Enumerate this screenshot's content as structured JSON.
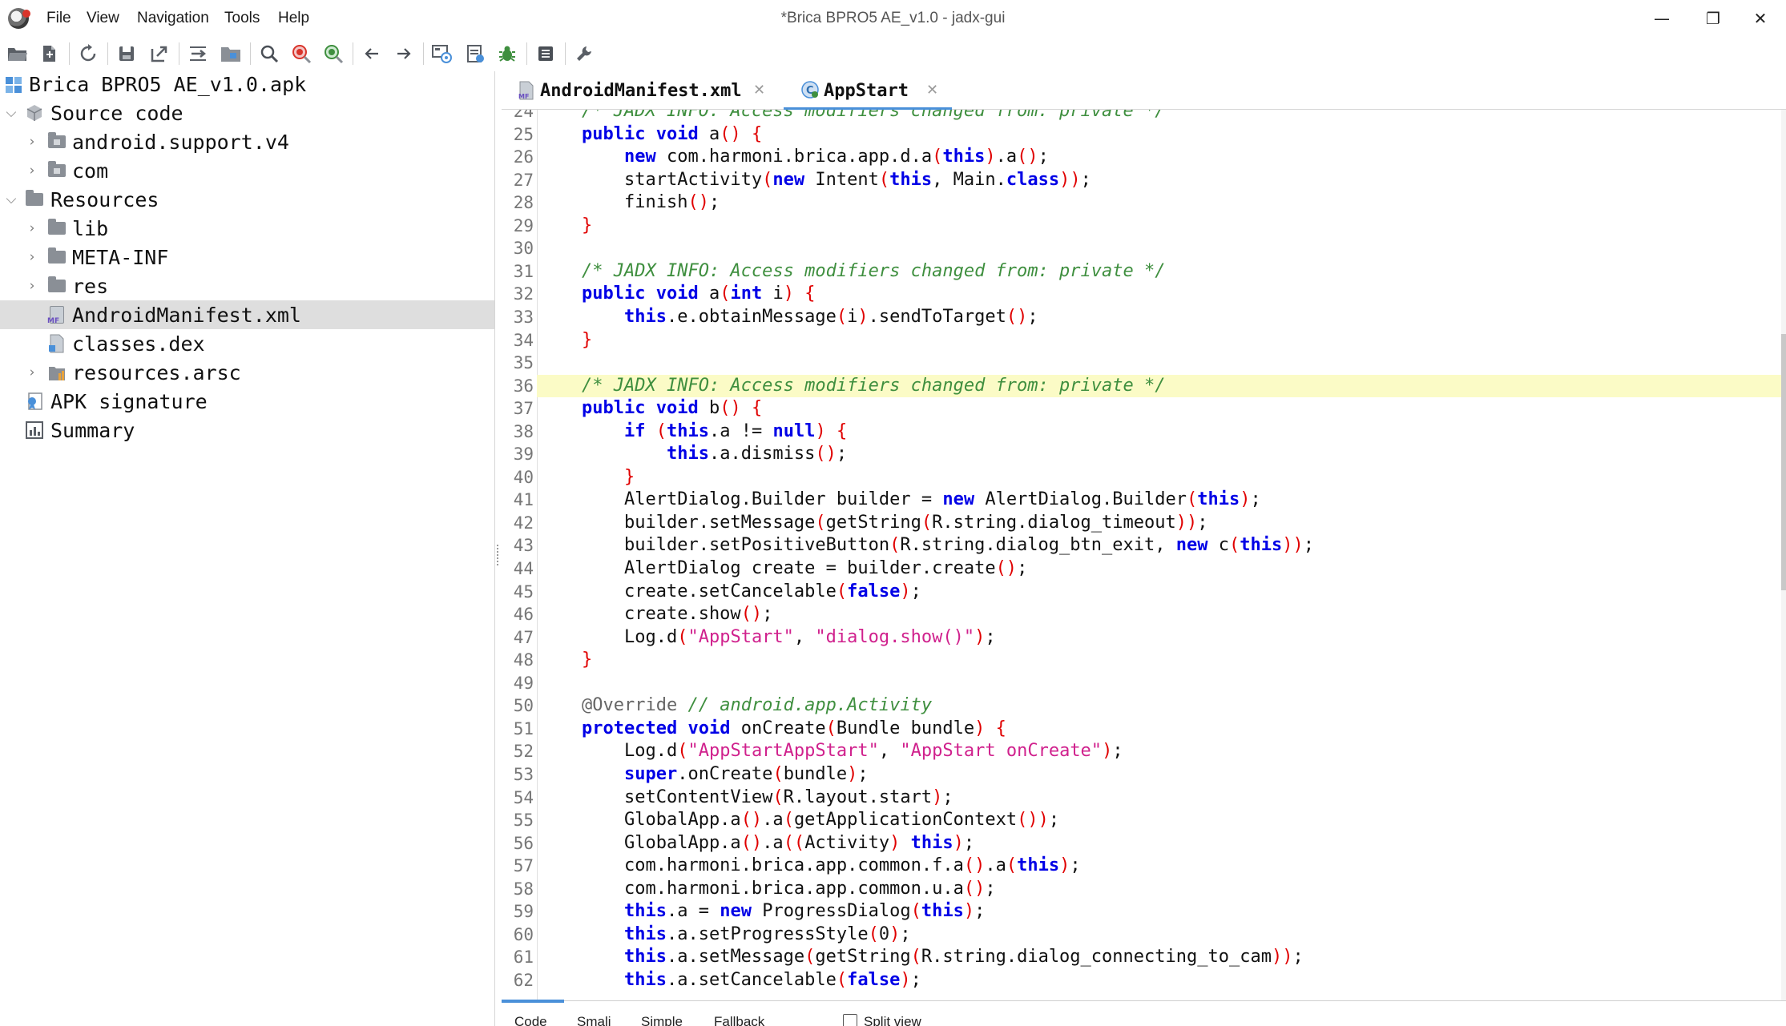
{
  "window": {
    "title": "*Brica BPRO5 AE_v1.0 - jadx-gui",
    "menu": [
      "File",
      "View",
      "Navigation",
      "Tools",
      "Help"
    ],
    "controls": {
      "minimize": "—",
      "restore": "❐",
      "close": "✕"
    }
  },
  "toolbar": {
    "buttons": [
      "open-file",
      "add-files",
      "sync",
      "save-all",
      "export",
      "sync-tree",
      "flatten-packages",
      "search-text",
      "search-class",
      "search-usage",
      "back",
      "forward",
      "deobfuscation",
      "decompile-all",
      "debug",
      "log-viewer",
      "preferences"
    ]
  },
  "tree": {
    "items": [
      {
        "label": "Brica BPRO5 AE_v1.0.apk",
        "icon": "apk-icon",
        "level": 0,
        "expander": ""
      },
      {
        "label": "Source code",
        "icon": "package-icon",
        "level": 0,
        "expander": "expanded"
      },
      {
        "label": "android.support.v4",
        "icon": "package-folder-icon",
        "level": 1,
        "expander": "collapsed"
      },
      {
        "label": "com",
        "icon": "package-folder-icon",
        "level": 1,
        "expander": "collapsed"
      },
      {
        "label": "Resources",
        "icon": "folder-icon",
        "level": 0,
        "expander": "expanded"
      },
      {
        "label": "lib",
        "icon": "folder-icon",
        "level": 1,
        "expander": "collapsed"
      },
      {
        "label": "META-INF",
        "icon": "folder-icon",
        "level": 1,
        "expander": "collapsed"
      },
      {
        "label": "res",
        "icon": "folder-icon",
        "level": 1,
        "expander": "collapsed"
      },
      {
        "label": "AndroidManifest.xml",
        "icon": "manifest-file-icon",
        "level": 1,
        "expander": "",
        "selected": true
      },
      {
        "label": "classes.dex",
        "icon": "dex-file-icon",
        "level": 1,
        "expander": ""
      },
      {
        "label": "resources.arsc",
        "icon": "arsc-file-icon",
        "level": 1,
        "expander": "collapsed"
      },
      {
        "label": "APK signature",
        "icon": "certificate-icon",
        "level": 0,
        "expander": ""
      },
      {
        "label": "Summary",
        "icon": "summary-icon",
        "level": 0,
        "expander": ""
      }
    ]
  },
  "tabs": [
    {
      "label": "AndroidManifest.xml",
      "close": "✕",
      "active": false
    },
    {
      "label": "AppStart",
      "close": "✕",
      "active": true
    }
  ],
  "code": {
    "highlight_line": 36,
    "lines": [
      {
        "n": "24",
        "tokens": [
          [
            "cm",
            "/* JADX INFO: Access modifiers changed from: private */"
          ]
        ]
      },
      {
        "n": "25",
        "tokens": [
          [
            "kw",
            "public"
          ],
          [
            "",
            " "
          ],
          [
            "kw",
            "void"
          ],
          [
            "",
            " a"
          ],
          [
            "br",
            "()"
          ],
          [
            "",
            " "
          ],
          [
            "br",
            "{"
          ]
        ]
      },
      {
        "n": "26",
        "tokens": [
          [
            "",
            "    "
          ],
          [
            "kw",
            "new"
          ],
          [
            "",
            " com.harmoni.brica.app.d.a"
          ],
          [
            "br",
            "("
          ],
          [
            "kw",
            "this"
          ],
          [
            "br",
            ")"
          ],
          [
            "",
            ".a"
          ],
          [
            "br",
            "()"
          ],
          [
            "",
            ";"
          ]
        ]
      },
      {
        "n": "27",
        "tokens": [
          [
            "",
            "    startActivity"
          ],
          [
            "br",
            "("
          ],
          [
            "kw",
            "new"
          ],
          [
            "",
            " Intent"
          ],
          [
            "br",
            "("
          ],
          [
            "kw",
            "this"
          ],
          [
            "",
            ", Main."
          ],
          [
            "kw",
            "class"
          ],
          [
            "br",
            "))"
          ],
          [
            "",
            ";"
          ]
        ]
      },
      {
        "n": "28",
        "tokens": [
          [
            "",
            "    finish"
          ],
          [
            "br",
            "()"
          ],
          [
            "",
            ";"
          ]
        ]
      },
      {
        "n": "29",
        "tokens": [
          [
            "br",
            "}"
          ]
        ]
      },
      {
        "n": "30",
        "tokens": []
      },
      {
        "n": "31",
        "tokens": [
          [
            "cm",
            "/* JADX INFO: Access modifiers changed from: private */"
          ]
        ]
      },
      {
        "n": "32",
        "tokens": [
          [
            "kw",
            "public"
          ],
          [
            "",
            " "
          ],
          [
            "kw",
            "void"
          ],
          [
            "",
            " a"
          ],
          [
            "br",
            "("
          ],
          [
            "kw",
            "int"
          ],
          [
            "",
            " i"
          ],
          [
            "br",
            ")"
          ],
          [
            "",
            " "
          ],
          [
            "br",
            "{"
          ]
        ]
      },
      {
        "n": "33",
        "tokens": [
          [
            "",
            "    "
          ],
          [
            "kw",
            "this"
          ],
          [
            "",
            ".e.obtainMessage"
          ],
          [
            "br",
            "("
          ],
          [
            "",
            "i"
          ],
          [
            "br",
            ")"
          ],
          [
            "",
            ".sendToTarget"
          ],
          [
            "br",
            "()"
          ],
          [
            "",
            ";"
          ]
        ]
      },
      {
        "n": "34",
        "tokens": [
          [
            "br",
            "}"
          ]
        ]
      },
      {
        "n": "35",
        "tokens": []
      },
      {
        "n": "36",
        "tokens": [
          [
            "cm",
            "/* JADX INFO: Access modifiers changed from: private */"
          ]
        ]
      },
      {
        "n": "37",
        "tokens": [
          [
            "kw",
            "public"
          ],
          [
            "",
            " "
          ],
          [
            "kw",
            "void"
          ],
          [
            "",
            " b"
          ],
          [
            "br",
            "()"
          ],
          [
            "",
            " "
          ],
          [
            "br",
            "{"
          ]
        ]
      },
      {
        "n": "38",
        "tokens": [
          [
            "",
            "    "
          ],
          [
            "kw",
            "if"
          ],
          [
            "",
            " "
          ],
          [
            "br",
            "("
          ],
          [
            "kw",
            "this"
          ],
          [
            "",
            ".a != "
          ],
          [
            "kw",
            "null"
          ],
          [
            "br",
            ")"
          ],
          [
            "",
            " "
          ],
          [
            "br",
            "{"
          ]
        ]
      },
      {
        "n": "39",
        "tokens": [
          [
            "",
            "        "
          ],
          [
            "kw",
            "this"
          ],
          [
            "",
            ".a.dismiss"
          ],
          [
            "br",
            "()"
          ],
          [
            "",
            ";"
          ]
        ]
      },
      {
        "n": "40",
        "tokens": [
          [
            "",
            "    "
          ],
          [
            "br",
            "}"
          ]
        ]
      },
      {
        "n": "41",
        "tokens": [
          [
            "",
            "    AlertDialog.Builder builder = "
          ],
          [
            "kw",
            "new"
          ],
          [
            "",
            " AlertDialog.Builder"
          ],
          [
            "br",
            "("
          ],
          [
            "kw",
            "this"
          ],
          [
            "br",
            ")"
          ],
          [
            "",
            ";"
          ]
        ]
      },
      {
        "n": "42",
        "tokens": [
          [
            "",
            "    builder.setMessage"
          ],
          [
            "br",
            "("
          ],
          [
            "",
            "getString"
          ],
          [
            "br",
            "("
          ],
          [
            "",
            "R.string.dialog_timeout"
          ],
          [
            "br",
            "))"
          ],
          [
            "",
            ";"
          ]
        ]
      },
      {
        "n": "43",
        "tokens": [
          [
            "",
            "    builder.setPositiveButton"
          ],
          [
            "br",
            "("
          ],
          [
            "",
            "R.string.dialog_btn_exit, "
          ],
          [
            "kw",
            "new"
          ],
          [
            "",
            " c"
          ],
          [
            "br",
            "("
          ],
          [
            "kw",
            "this"
          ],
          [
            "br",
            "))"
          ],
          [
            "",
            ";"
          ]
        ]
      },
      {
        "n": "44",
        "tokens": [
          [
            "",
            "    AlertDialog create = builder.create"
          ],
          [
            "br",
            "()"
          ],
          [
            "",
            ";"
          ]
        ]
      },
      {
        "n": "45",
        "tokens": [
          [
            "",
            "    create.setCancelable"
          ],
          [
            "br",
            "("
          ],
          [
            "kw",
            "false"
          ],
          [
            "br",
            ")"
          ],
          [
            "",
            ";"
          ]
        ]
      },
      {
        "n": "46",
        "tokens": [
          [
            "",
            "    create.show"
          ],
          [
            "br",
            "()"
          ],
          [
            "",
            ";"
          ]
        ]
      },
      {
        "n": "47",
        "tokens": [
          [
            "",
            "    Log.d"
          ],
          [
            "br",
            "("
          ],
          [
            "str",
            "\"AppStart\""
          ],
          [
            "",
            ", "
          ],
          [
            "str",
            "\"dialog.show()\""
          ],
          [
            "br",
            ")"
          ],
          [
            "",
            ";"
          ]
        ]
      },
      {
        "n": "48",
        "tokens": [
          [
            "br",
            "}"
          ]
        ]
      },
      {
        "n": "49",
        "tokens": []
      },
      {
        "n": "50",
        "tokens": [
          [
            "an",
            "@Override"
          ],
          [
            "",
            " "
          ],
          [
            "cm",
            "// android.app.Activity"
          ]
        ]
      },
      {
        "n": "51",
        "tokens": [
          [
            "kw",
            "protected"
          ],
          [
            "",
            " "
          ],
          [
            "kw",
            "void"
          ],
          [
            "",
            " onCreate"
          ],
          [
            "br",
            "("
          ],
          [
            "",
            "Bundle bundle"
          ],
          [
            "br",
            ")"
          ],
          [
            "",
            " "
          ],
          [
            "br",
            "{"
          ]
        ]
      },
      {
        "n": "52",
        "tokens": [
          [
            "",
            "    Log.d"
          ],
          [
            "br",
            "("
          ],
          [
            "str",
            "\"AppStartAppStart\""
          ],
          [
            "",
            ", "
          ],
          [
            "str",
            "\"AppStart onCreate\""
          ],
          [
            "br",
            ")"
          ],
          [
            "",
            ";"
          ]
        ]
      },
      {
        "n": "53",
        "tokens": [
          [
            "",
            "    "
          ],
          [
            "kw",
            "super"
          ],
          [
            "",
            ".onCreate"
          ],
          [
            "br",
            "("
          ],
          [
            "",
            "bundle"
          ],
          [
            "br",
            ")"
          ],
          [
            "",
            ";"
          ]
        ]
      },
      {
        "n": "54",
        "tokens": [
          [
            "",
            "    setContentView"
          ],
          [
            "br",
            "("
          ],
          [
            "",
            "R.layout.start"
          ],
          [
            "br",
            ")"
          ],
          [
            "",
            ";"
          ]
        ]
      },
      {
        "n": "55",
        "tokens": [
          [
            "",
            "    GlobalApp.a"
          ],
          [
            "br",
            "()"
          ],
          [
            "",
            ".a"
          ],
          [
            "br",
            "("
          ],
          [
            "",
            "getApplicationContext"
          ],
          [
            "br",
            "())"
          ],
          [
            "",
            ";"
          ]
        ]
      },
      {
        "n": "56",
        "tokens": [
          [
            "",
            "    GlobalApp.a"
          ],
          [
            "br",
            "()"
          ],
          [
            "",
            ".a"
          ],
          [
            "br",
            "(("
          ],
          [
            "",
            "Activity"
          ],
          [
            "br",
            ")"
          ],
          [
            "",
            " "
          ],
          [
            "kw",
            "this"
          ],
          [
            "br",
            ")"
          ],
          [
            "",
            ";"
          ]
        ]
      },
      {
        "n": "57",
        "tokens": [
          [
            "",
            "    com.harmoni.brica.app.common.f.a"
          ],
          [
            "br",
            "()"
          ],
          [
            "",
            ".a"
          ],
          [
            "br",
            "("
          ],
          [
            "kw",
            "this"
          ],
          [
            "br",
            ")"
          ],
          [
            "",
            ";"
          ]
        ]
      },
      {
        "n": "58",
        "tokens": [
          [
            "",
            "    com.harmoni.brica.app.common.u.a"
          ],
          [
            "br",
            "()"
          ],
          [
            "",
            ";"
          ]
        ]
      },
      {
        "n": "59",
        "tokens": [
          [
            "",
            "    "
          ],
          [
            "kw",
            "this"
          ],
          [
            "",
            ".a = "
          ],
          [
            "kw",
            "new"
          ],
          [
            "",
            " ProgressDialog"
          ],
          [
            "br",
            "("
          ],
          [
            "kw",
            "this"
          ],
          [
            "br",
            ")"
          ],
          [
            "",
            ";"
          ]
        ]
      },
      {
        "n": "60",
        "tokens": [
          [
            "",
            "    "
          ],
          [
            "kw",
            "this"
          ],
          [
            "",
            ".a.setProgressStyle"
          ],
          [
            "br",
            "("
          ],
          [
            "num",
            "0"
          ],
          [
            "br",
            ")"
          ],
          [
            "",
            ";"
          ]
        ]
      },
      {
        "n": "61",
        "tokens": [
          [
            "",
            "    "
          ],
          [
            "kw",
            "this"
          ],
          [
            "",
            ".a.setMessage"
          ],
          [
            "br",
            "("
          ],
          [
            "",
            "getString"
          ],
          [
            "br",
            "("
          ],
          [
            "",
            "R.string.dialog_connecting_to_cam"
          ],
          [
            "br",
            "))"
          ],
          [
            "",
            ";"
          ]
        ]
      },
      {
        "n": "62",
        "tokens": [
          [
            "",
            "    "
          ],
          [
            "kw",
            "this"
          ],
          [
            "",
            ".a.setCancelable"
          ],
          [
            "br",
            "("
          ],
          [
            "kw",
            "false"
          ],
          [
            "br",
            ")"
          ],
          [
            "",
            ";"
          ]
        ]
      }
    ]
  },
  "bottom_tabs": {
    "items": [
      "Code",
      "Smali",
      "Simple",
      "Fallback"
    ],
    "active": "Code",
    "split_view_label": "Split view"
  },
  "colors": {
    "keyword": "#0000e6",
    "comment": "#3f8f3f",
    "string": "#d0218d",
    "brace": "#e00000",
    "highlight_line": "#fbfbc6",
    "selection": "#dedede",
    "accent": "#4a90d9"
  }
}
